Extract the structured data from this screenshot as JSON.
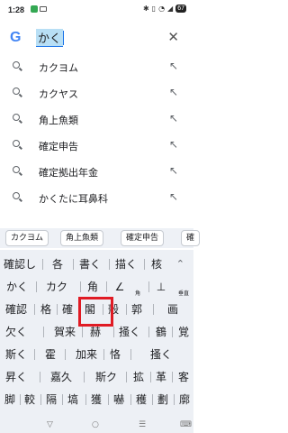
{
  "status_bar": {
    "time": "1:28",
    "battery": "67"
  },
  "search": {
    "logo": "G",
    "query": "かく",
    "clear_icon": "close-icon"
  },
  "suggestions": [
    {
      "text": "カクヨム"
    },
    {
      "text": "カクヤス"
    },
    {
      "text": "角上魚類"
    },
    {
      "text": "確定申告"
    },
    {
      "text": "確定拠出年金"
    },
    {
      "text": "かくたに耳鼻科"
    }
  ],
  "chips": [
    "カクヨム",
    "角上魚類",
    "確定申告",
    "確"
  ],
  "keyboard": {
    "rows": [
      [
        "確認し",
        "各",
        "書く",
        "描く",
        "核"
      ],
      [
        "かく",
        "カク",
        "角",
        "∠",
        "⊥"
      ],
      [
        "確認",
        "格",
        "確",
        "閣",
        "殻",
        "郭",
        "画"
      ],
      [
        "欠く",
        "賀来",
        "赫",
        "掻く",
        "鶴",
        "覚"
      ],
      [
        "斯く",
        "霍",
        "加来",
        "恪",
        "搔く"
      ],
      [
        "昇く",
        "嘉久",
        "斯ク",
        "拡",
        "革",
        "客"
      ],
      [
        "脚",
        "較",
        "隔",
        "塙",
        "獲",
        "嚇",
        "穫",
        "劃",
        "廓"
      ]
    ],
    "sub_labels": {
      "angle": "角",
      "perp": "垂直"
    },
    "collapse_icon": "chevron-up-icon"
  },
  "nav": {
    "back": "▽",
    "home": "○",
    "menu": "☰",
    "keyboard": "⌨"
  },
  "colors": {
    "highlight": "#e01b24",
    "selection": "#b8dff5",
    "keyboard_bg": "#edf0f5"
  }
}
